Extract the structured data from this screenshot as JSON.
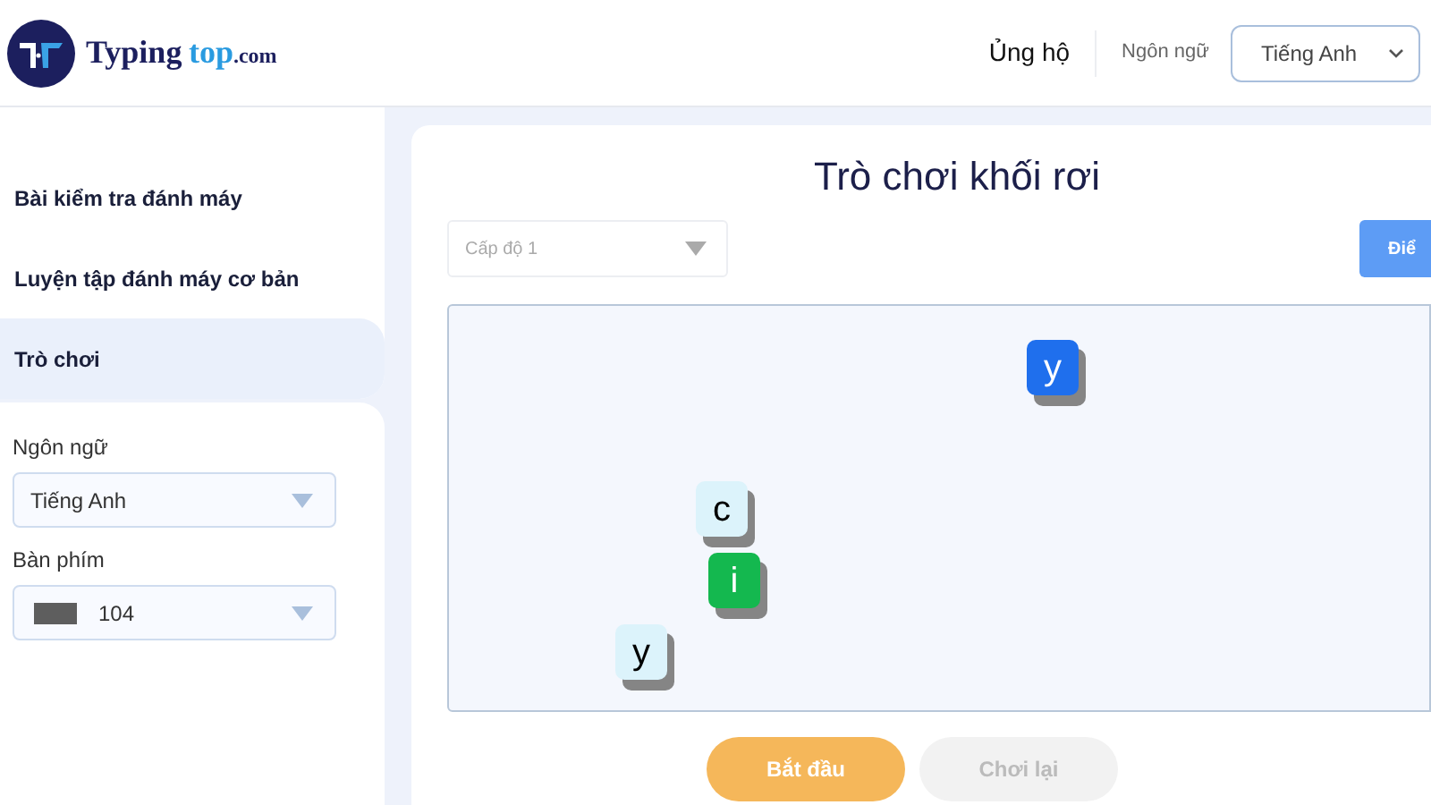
{
  "header": {
    "logo": {
      "brand": "Typing",
      "accent": "top",
      "suffix": ".com"
    },
    "support_link": "Ủng hộ",
    "language_label": "Ngôn ngữ",
    "language_select": {
      "value": "Tiếng Anh"
    }
  },
  "sidebar": {
    "items": [
      {
        "label": "Bài kiểm tra đánh máy",
        "selected": false
      },
      {
        "label": "Luyện tập đánh máy cơ bản",
        "selected": false
      },
      {
        "label": "Trò chơi",
        "selected": true
      }
    ],
    "language": {
      "label": "Ngôn ngữ",
      "value": "Tiếng Anh"
    },
    "keyboard": {
      "label": "Bàn phím",
      "value": "104"
    }
  },
  "game": {
    "title": "Trò chơi khối rơi",
    "level_select": {
      "value": "Cấp độ 1"
    },
    "score_button": "Điể",
    "blocks": [
      {
        "letter": "y",
        "color": "#1f6fed"
      },
      {
        "letter": "c",
        "color": "#dcf3fb"
      },
      {
        "letter": "i",
        "color": "#14b84f"
      },
      {
        "letter": "y",
        "color": "#dcf3fb"
      }
    ],
    "buttons": [
      {
        "label": "Bắt đầu",
        "disabled": false
      },
      {
        "label": "Chơi lại",
        "disabled": true
      }
    ]
  }
}
